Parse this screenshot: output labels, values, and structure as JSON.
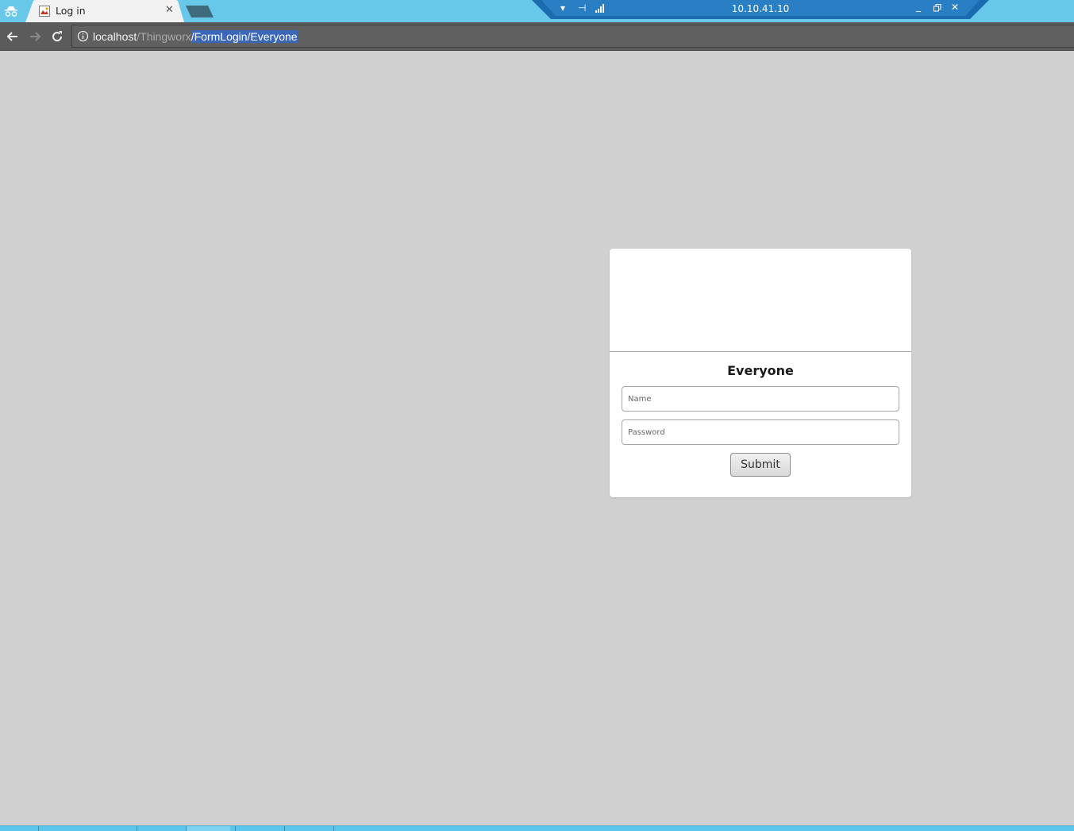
{
  "browser": {
    "incognito_icon": "incognito-icon",
    "tab": {
      "title": "Log in",
      "favicon": "page-icon",
      "close_label": "✕"
    },
    "new_tab_icon": "new-tab-icon",
    "url": {
      "host": "localhost",
      "path_dim": "/Thingworx",
      "path_selected": "/FormLogin/Everyone"
    }
  },
  "remote_session": {
    "title": "10.10.41.10",
    "icons": [
      "dropdown-icon",
      "pin-icon",
      "signal-icon",
      "minimize-icon",
      "restore-icon",
      "close-icon"
    ]
  },
  "login": {
    "heading": "Everyone",
    "name_placeholder": "Name",
    "password_placeholder": "Password",
    "submit_label": "Submit"
  },
  "colors": {
    "page_background": "#d0d0d0",
    "tabstrip": "#68c8ea",
    "toolbar": "#5b5b5b",
    "url_selection": "#3b67b8",
    "rdp_bar": "#1a6bb0"
  }
}
